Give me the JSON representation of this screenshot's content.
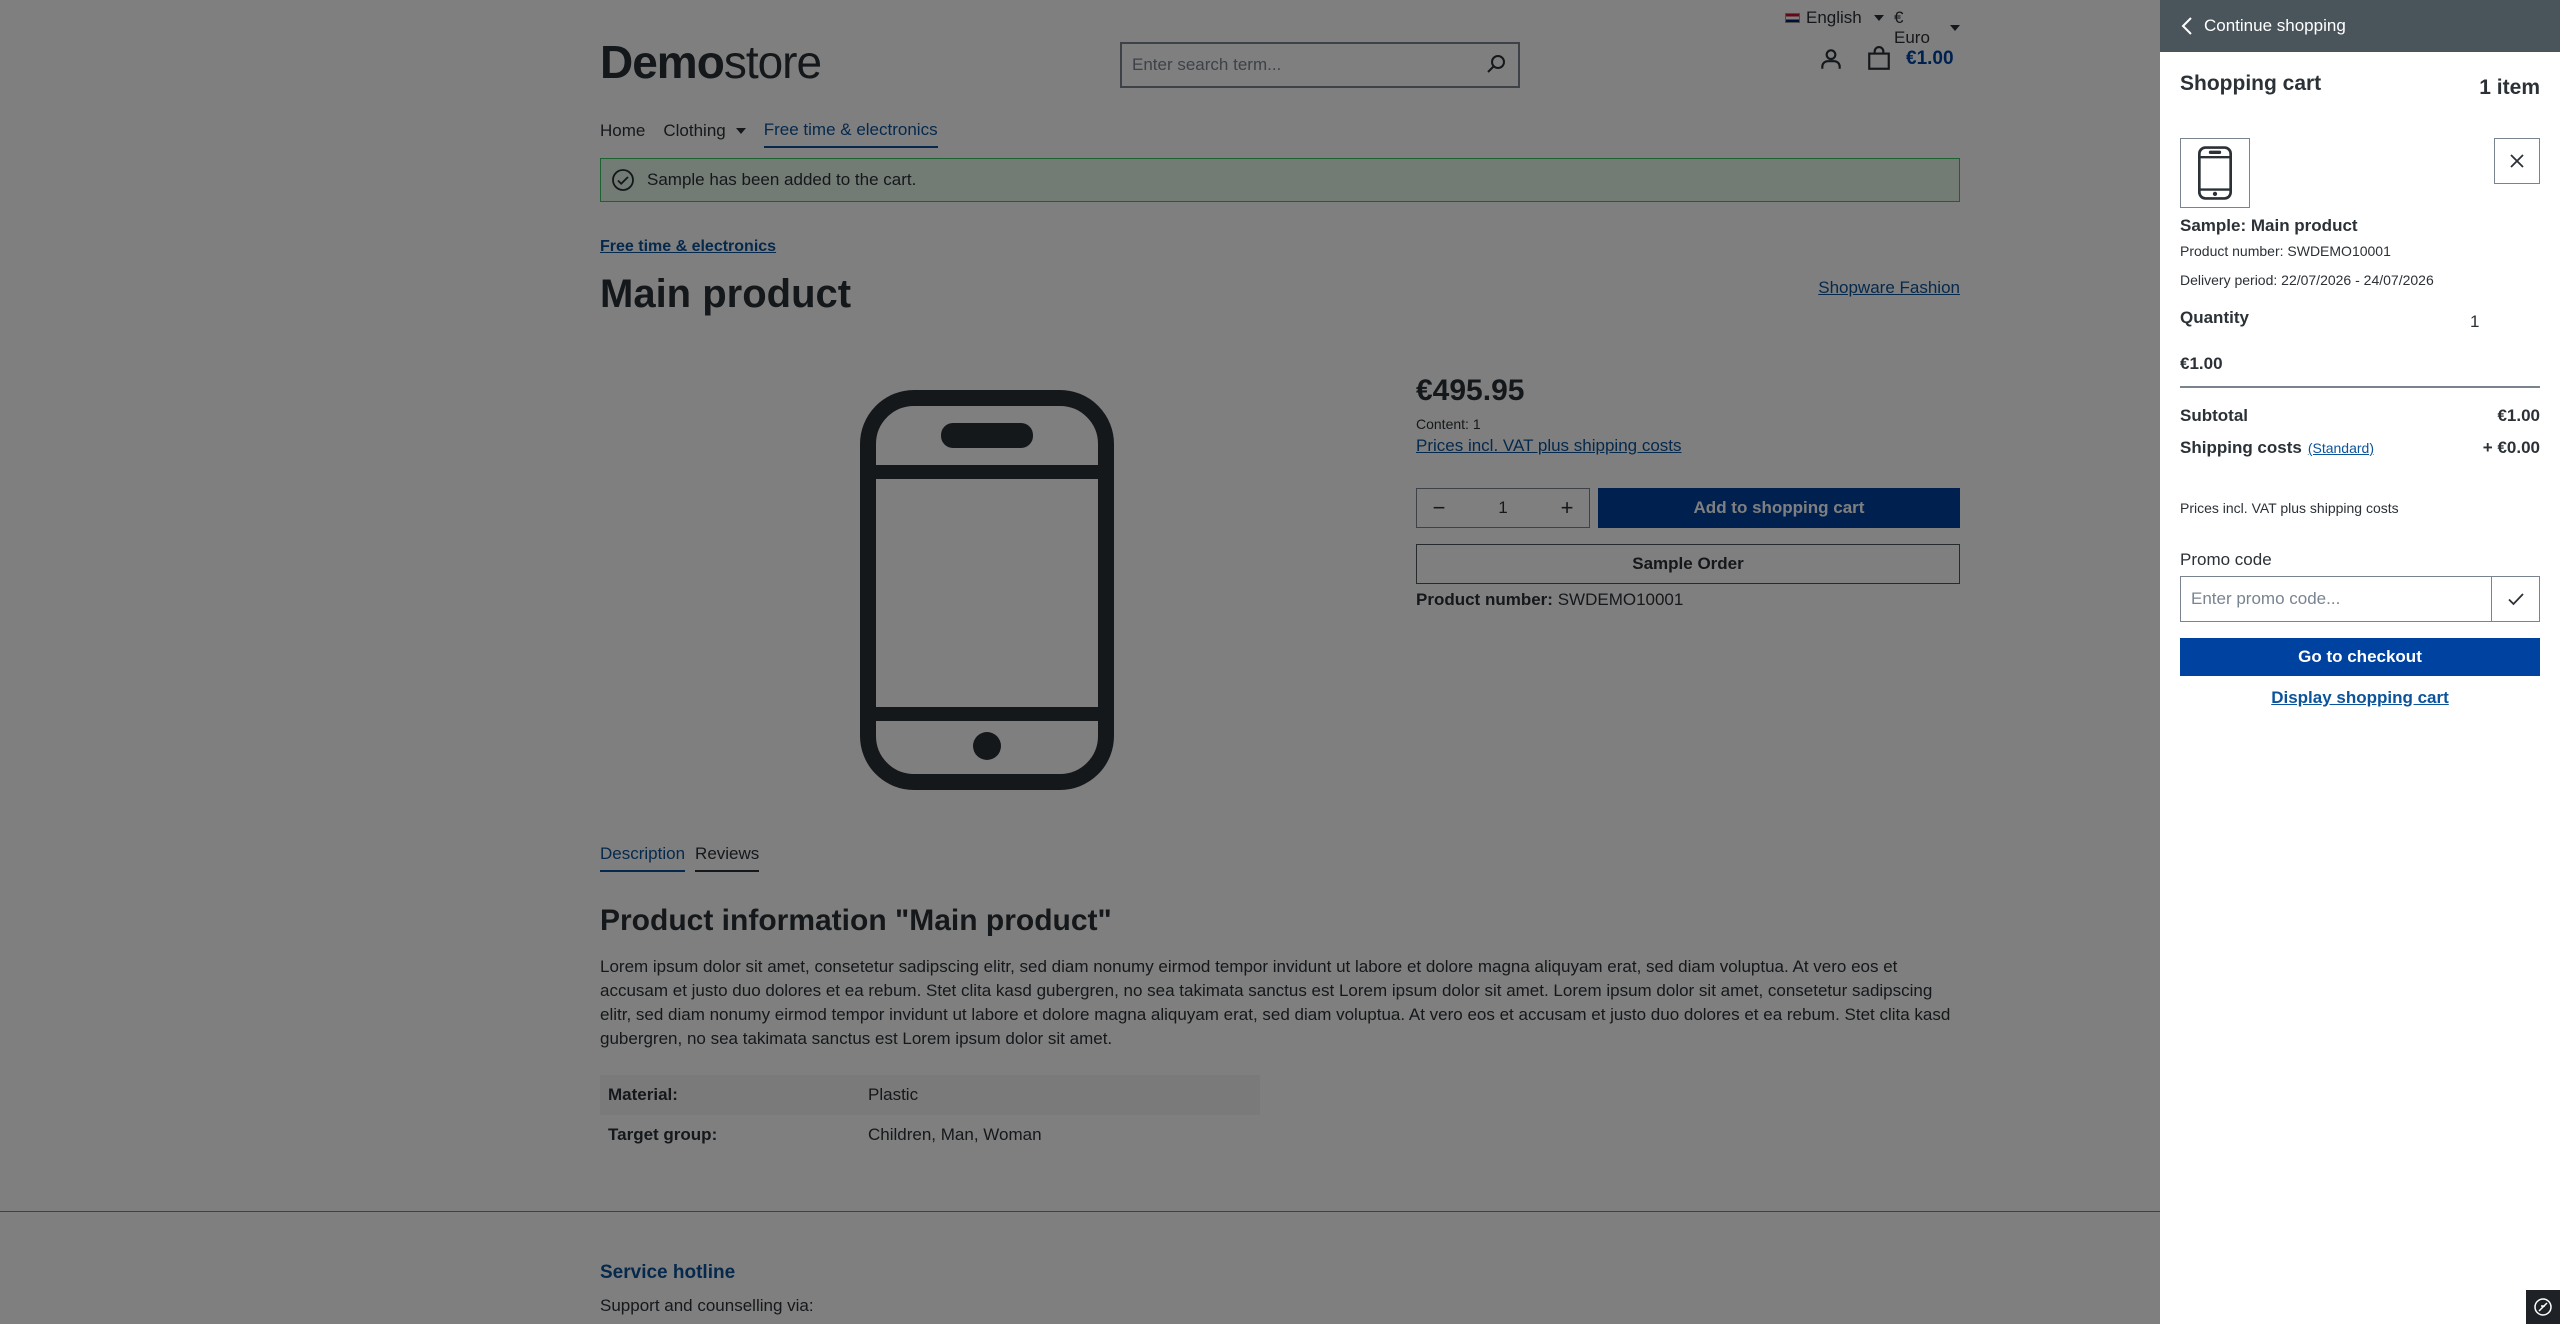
{
  "topbar": {
    "language": "English",
    "currency": "€ Euro"
  },
  "header": {
    "logo_bold": "Demo",
    "logo_light": "store",
    "search_placeholder": "Enter search term...",
    "cart_total": "€1.00"
  },
  "nav": {
    "items": [
      "Home",
      "Clothing",
      "Free time & electronics"
    ]
  },
  "alert": {
    "text": "Sample has been added to the cart."
  },
  "product": {
    "breadcrumb": "Free time & electronics",
    "title": "Main product",
    "manufacturer": "Shopware Fashion",
    "price": "€495.95",
    "content": "Content: 1",
    "vat_link": "Prices incl. VAT plus shipping costs",
    "quantity": "1",
    "add_to_cart": "Add to shopping cart",
    "sample_order": "Sample Order",
    "product_number_label": "Product number:",
    "product_number": "SWDEMO10001"
  },
  "tabs": [
    "Description",
    "Reviews"
  ],
  "description": {
    "title": "Product information \"Main product\"",
    "text": "Lorem ipsum dolor sit amet, consetetur sadipscing elitr, sed diam nonumy eirmod tempor invidunt ut labore et dolore magna aliquyam erat, sed diam voluptua. At vero eos et accusam et justo duo dolores et ea rebum. Stet clita kasd gubergren, no sea takimata sanctus est Lorem ipsum dolor sit amet. Lorem ipsum dolor sit amet, consetetur sadipscing elitr, sed diam nonumy eirmod tempor invidunt ut labore et dolore magna aliquyam erat, sed diam voluptua. At vero eos et accusam et justo duo dolores et ea rebum. Stet clita kasd gubergren, no sea takimata sanctus est Lorem ipsum dolor sit amet.",
    "properties": [
      {
        "key": "Material:",
        "value": "Plastic"
      },
      {
        "key": "Target group:",
        "value": "Children, Man, Woman"
      }
    ]
  },
  "footer": {
    "hotline_title": "Service hotline",
    "hotline_text": "Support and counselling via:"
  },
  "offcanvas": {
    "back": "Continue shopping",
    "title": "Shopping cart",
    "count": "1 item",
    "line_item": {
      "name": "Sample: Main product",
      "number": "Product number: SWDEMO10001",
      "delivery": "Delivery period: 22/07/2026 - 24/07/2026",
      "quantity_label": "Quantity",
      "quantity": "1",
      "price": "€1.00"
    },
    "subtotal_label": "Subtotal",
    "subtotal": "€1.00",
    "shipping_label": "Shipping costs",
    "shipping_method": "(Standard)",
    "shipping": "+ €0.00",
    "vat_note": "Prices incl. VAT plus shipping costs",
    "promo_label": "Promo code",
    "promo_placeholder": "Enter promo code...",
    "checkout": "Go to checkout",
    "display_cart": "Display shopping cart"
  },
  "colors": {
    "primary": "#0042a0",
    "link": "#0b539b",
    "success_border": "#3cc261",
    "offcanvas_header": "#4a545b"
  },
  "icons": [
    "chevron-left-icon",
    "account-icon",
    "bag-icon",
    "search-icon",
    "check-circle-icon",
    "phone-icon",
    "close-icon",
    "check-icon",
    "caret-down-icon"
  ]
}
